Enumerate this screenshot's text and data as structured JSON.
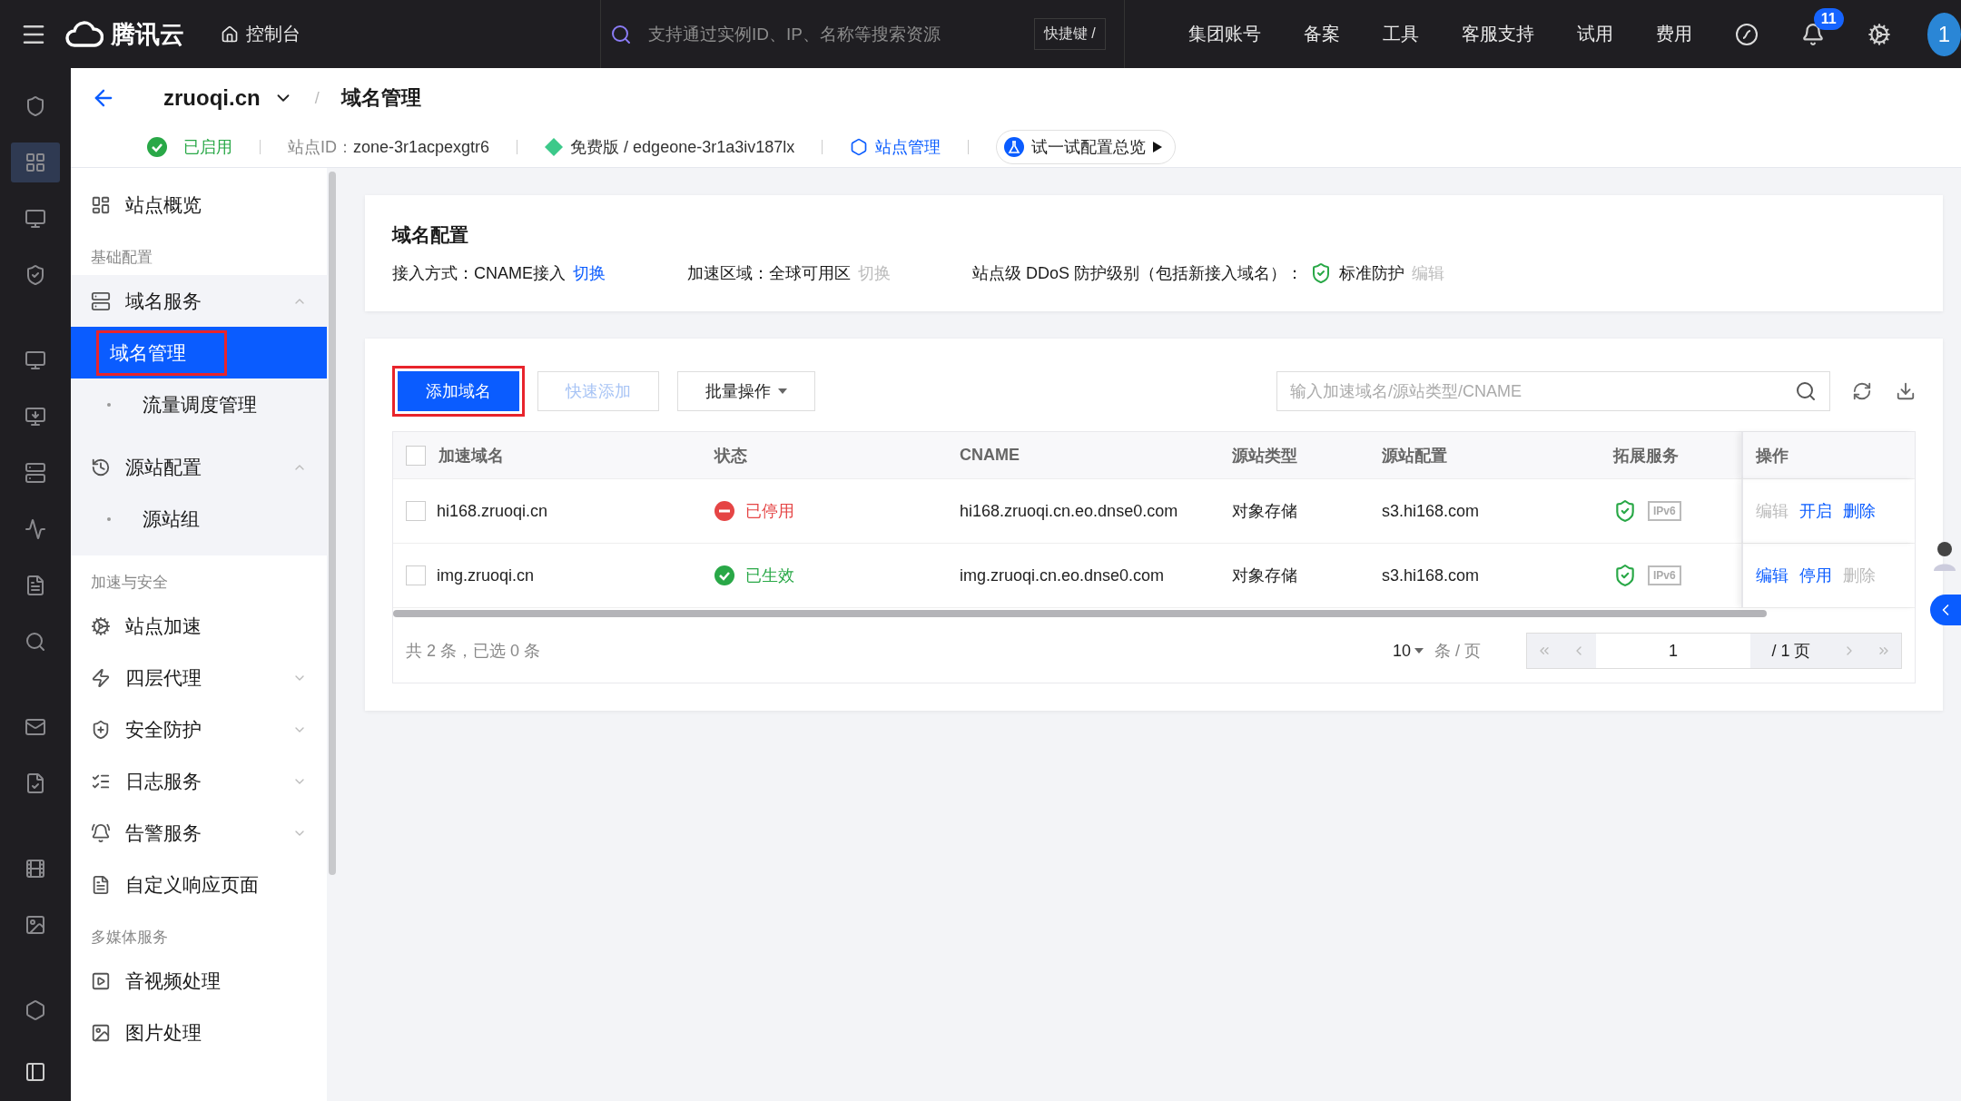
{
  "topbar": {
    "logo": "腾讯云",
    "console": "控制台",
    "search_placeholder": "支持通过实例ID、IP、名称等搜索资源",
    "shortcut": "快捷键 /",
    "nav_links": [
      "集团账号",
      "备案",
      "工具",
      "客服支持",
      "试用",
      "费用"
    ],
    "notification_count": "11",
    "avatar": "1"
  },
  "header": {
    "site": "zruoqi.cn",
    "separator": "/",
    "page": "域名管理",
    "status": "已启用",
    "site_id_label": "站点ID：",
    "site_id": "zone-3r1acpexgtr6",
    "plan": "免费版 / edgeone-3r1a3iv187lx",
    "manage_link": "站点管理",
    "try_button": "试一试配置总览"
  },
  "sidebar": [
    {
      "kind": "item",
      "label": "站点概览"
    },
    {
      "kind": "section",
      "label": "基础配置"
    },
    {
      "kind": "group",
      "label": "域名服务",
      "expanded": true,
      "children": [
        {
          "label": "域名管理",
          "selected": true,
          "highlighted": true
        },
        {
          "label": "流量调度管理",
          "selected": false,
          "highlighted": false
        }
      ]
    },
    {
      "kind": "group",
      "label": "源站配置",
      "expanded": true,
      "children": [
        {
          "label": "源站组",
          "selected": false,
          "highlighted": false
        }
      ]
    },
    {
      "kind": "section",
      "label": "加速与安全"
    },
    {
      "kind": "item",
      "label": "站点加速"
    },
    {
      "kind": "group",
      "label": "四层代理",
      "expanded": false
    },
    {
      "kind": "group",
      "label": "安全防护",
      "expanded": false
    },
    {
      "kind": "group",
      "label": "日志服务",
      "expanded": false
    },
    {
      "kind": "group",
      "label": "告警服务",
      "expanded": false
    },
    {
      "kind": "item",
      "label": "自定义响应页面"
    },
    {
      "kind": "section",
      "label": "多媒体服务"
    },
    {
      "kind": "item",
      "label": "音视频处理"
    },
    {
      "kind": "item",
      "label": "图片处理"
    }
  ],
  "config_card": {
    "title": "域名配置",
    "fields": [
      {
        "label": "接入方式：CNAME接入",
        "action": "切换",
        "action_disabled": false
      },
      {
        "label": "加速区域：全球可用区",
        "action": "切换",
        "action_disabled": true
      },
      {
        "label": "站点级 DDoS 防护级别（包括新接入域名）：",
        "value": "标准防护",
        "action": "编辑",
        "action_disabled": true
      }
    ]
  },
  "toolbar": {
    "buttons": [
      {
        "label": "添加域名",
        "kind": "primary",
        "highlighted": true
      },
      {
        "label": "快速添加",
        "kind": "disabled"
      },
      {
        "label": "批量操作",
        "kind": "dropdown"
      }
    ],
    "search_placeholder": "输入加速域名/源站类型/CNAME"
  },
  "table": {
    "header_checked": false,
    "columns": [
      "加速域名",
      "状态",
      "CNAME",
      "源站类型",
      "源站配置",
      "拓展服务",
      "操作"
    ],
    "rows": [
      {
        "checked": false,
        "domain": "hi168.zruoqi.cn",
        "status": {
          "text": "已停用",
          "kind": "stopped"
        },
        "cname": "hi168.zruoqi.cn.eo.dnse0.com",
        "origin_type": "对象存储",
        "origin": "s3.hi168.com",
        "ipv6": "IPv6",
        "actions": [
          {
            "label": "编辑",
            "disabled": true
          },
          {
            "label": "开启",
            "disabled": false
          },
          {
            "label": "删除",
            "disabled": false
          }
        ]
      },
      {
        "checked": false,
        "domain": "img.zruoqi.cn",
        "status": {
          "text": "已生效",
          "kind": "active"
        },
        "cname": "img.zruoqi.cn.eo.dnse0.com",
        "origin_type": "对象存储",
        "origin": "s3.hi168.com",
        "ipv6": "IPv6",
        "actions": [
          {
            "label": "编辑",
            "disabled": false
          },
          {
            "label": "停用",
            "disabled": false
          },
          {
            "label": "删除",
            "disabled": true
          }
        ]
      }
    ]
  },
  "pagination": {
    "summary": "共 2 条，已选 0 条",
    "page_size": "10",
    "per_page": "条 / 页",
    "page": "1",
    "pages": "/ 1 页"
  }
}
